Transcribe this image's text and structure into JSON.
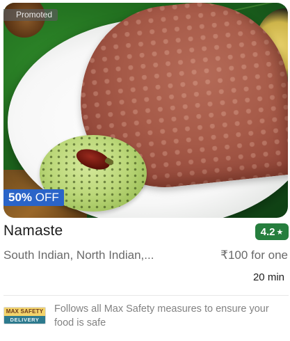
{
  "restaurant": {
    "promoted_label": "Promoted",
    "offer": {
      "amount": "50%",
      "suffix": "OFF"
    },
    "name": "Namaste",
    "rating": "4.2",
    "rating_icon": "star-icon",
    "cuisines": "South Indian, North Indian,...",
    "price": "₹100 for one",
    "delivery_time": "20 min"
  },
  "safety": {
    "badge_line1": "MAX SAFETY",
    "badge_line2": "DELIVERY",
    "text": "Follows all Max Safety measures to ensure your food is safe"
  },
  "colors": {
    "rating_green": "#267e3e",
    "offer_blue": "#2a64c8",
    "muted_text": "#696969"
  }
}
